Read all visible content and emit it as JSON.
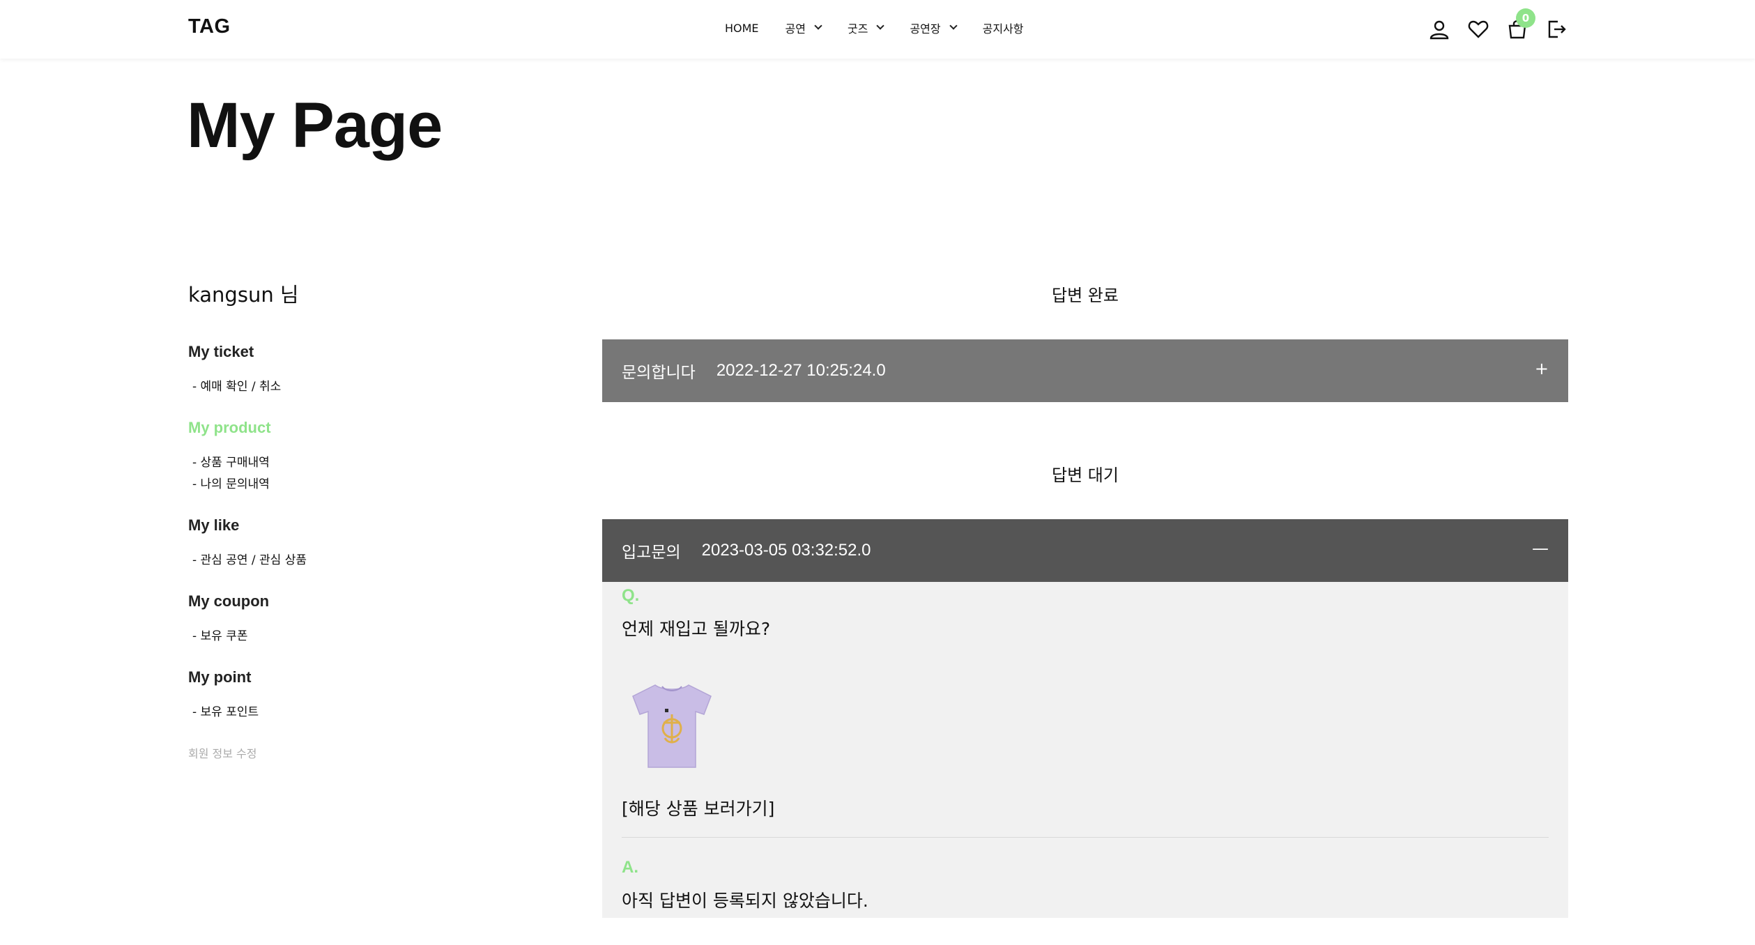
{
  "header": {
    "logo": "TAG",
    "nav": [
      {
        "label": "HOME",
        "has_dropdown": false
      },
      {
        "label": "공연",
        "has_dropdown": true
      },
      {
        "label": "굿즈",
        "has_dropdown": true
      },
      {
        "label": "공연장",
        "has_dropdown": true
      },
      {
        "label": "공지사항",
        "has_dropdown": false
      }
    ],
    "icons": [
      "user-icon",
      "heart-icon",
      "cart-icon",
      "logout-icon"
    ],
    "cart_count": "0"
  },
  "page_title": "My Page",
  "sidebar": {
    "username": "kangsun 님",
    "groups": [
      {
        "title": "My ticket",
        "items": [
          "- 예매 확인 / 취소"
        ]
      },
      {
        "title": "My product",
        "items": [
          "- 상품 구매내역",
          "- 나의 문의내역"
        ]
      },
      {
        "title": "My like",
        "items": [
          "- 관심 공연 / 관심 상품"
        ]
      },
      {
        "title": "My coupon",
        "items": [
          "- 보유 쿠폰"
        ]
      },
      {
        "title": "My point",
        "items": [
          "- 보유 포인트"
        ]
      }
    ],
    "edit_profile": "회원 정보 수정"
  },
  "main": {
    "answered": {
      "label": "답변 완료",
      "title": "문의합니다",
      "date": "2022-12-27 10:25:24.0",
      "toggle": "+"
    },
    "pending": {
      "label": "답변 대기",
      "title": "입고문의",
      "date": "2023-03-05 03:32:52.0",
      "toggle": "—",
      "q_label": "Q.",
      "question": "언제 재입고 될까요?",
      "product_link": "[해당 상품 보러가기]",
      "a_label": "A.",
      "answer": "아직 답변이 등록되지 않았습니다."
    }
  },
  "colors": {
    "accent": "#8fe38a",
    "bar_answered": "#777777",
    "bar_pending": "#555555",
    "panel_bg": "#f1f1f1"
  }
}
